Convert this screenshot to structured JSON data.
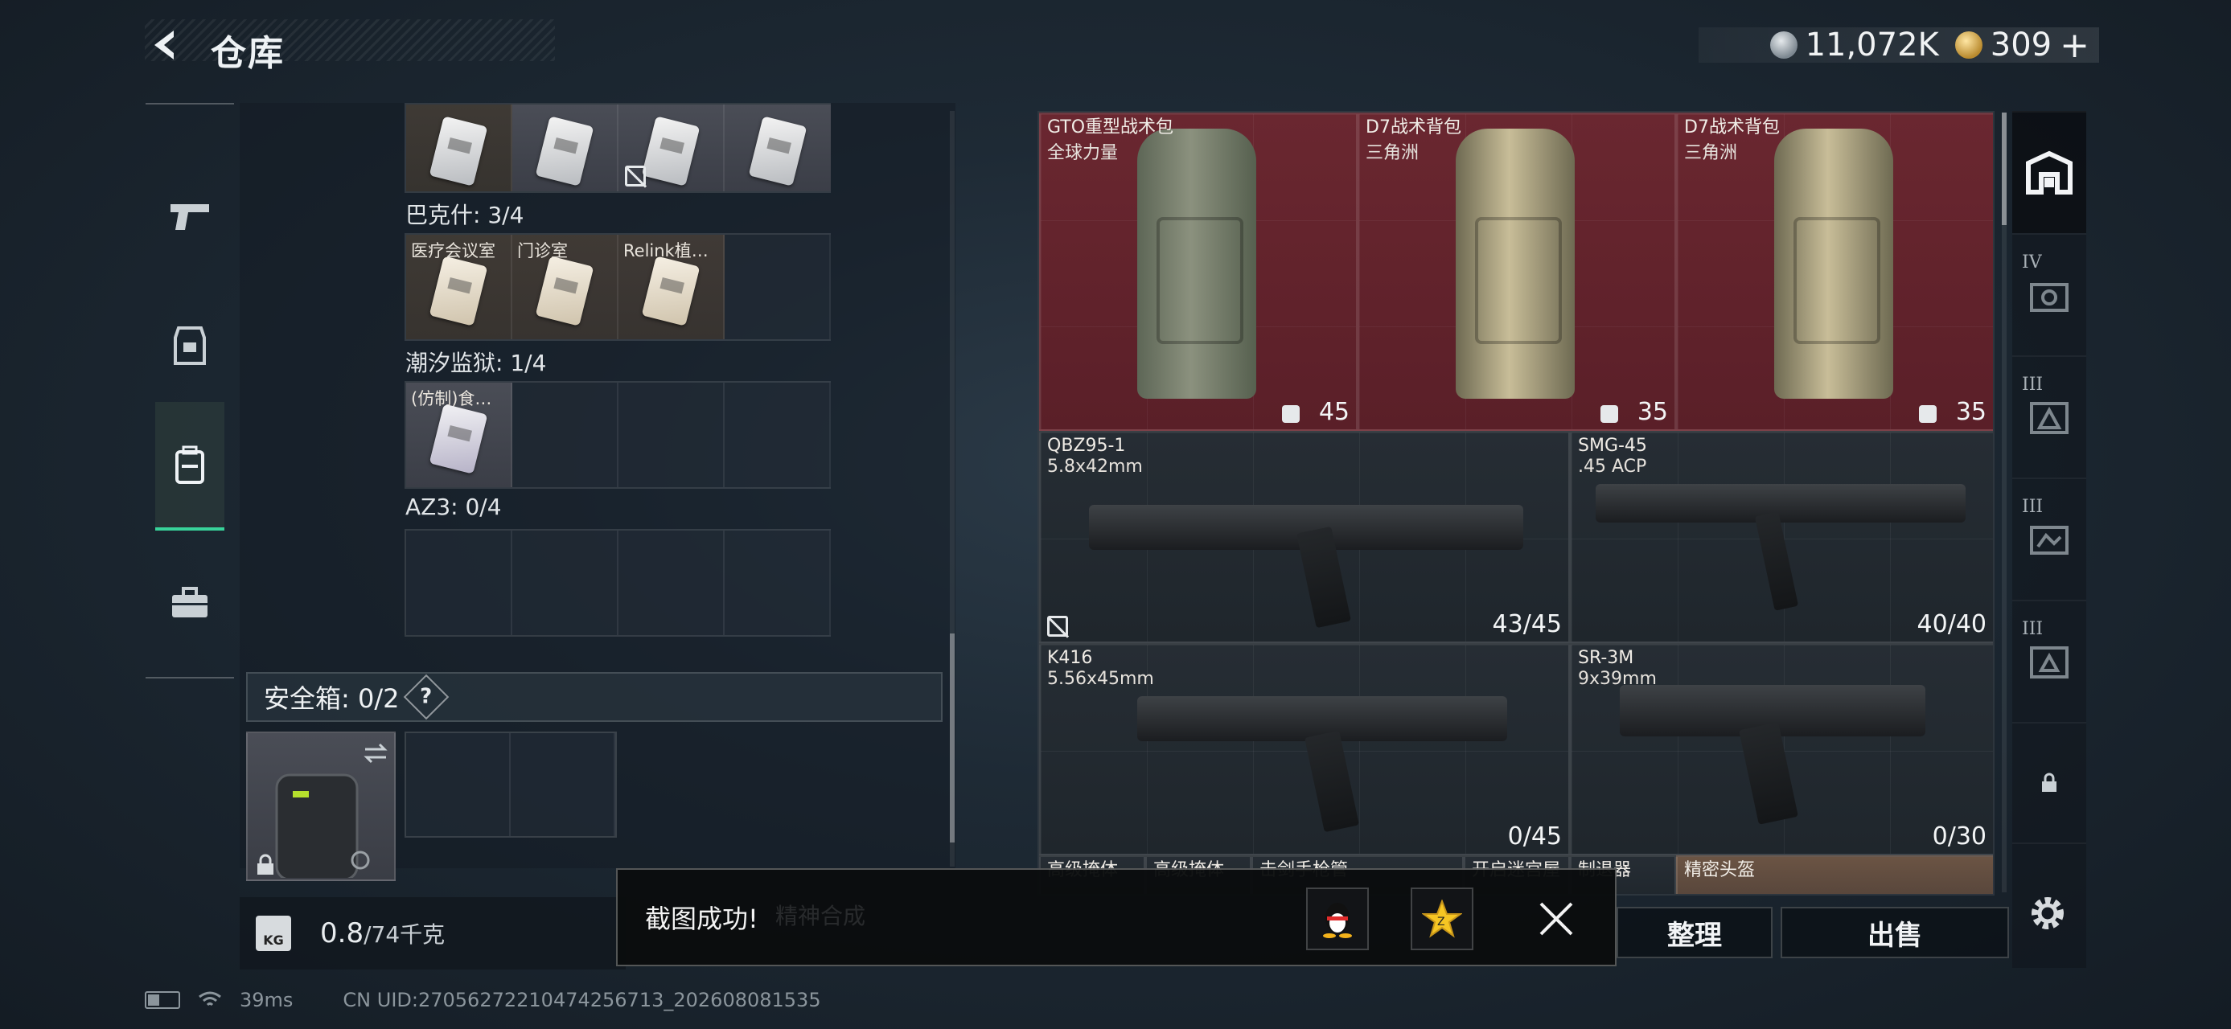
{
  "header": {
    "title": "仓库",
    "currency_silver": "11,072K",
    "currency_gold": "309",
    "currency_plus": "+"
  },
  "left_nav": {
    "items": [
      {
        "icon": "pistol-icon"
      },
      {
        "icon": "armor-vest-icon"
      },
      {
        "icon": "backpack-icon",
        "active": true
      },
      {
        "icon": "toolbox-icon"
      }
    ]
  },
  "storage": {
    "sections": [
      {
        "label": "巴克什: 3/4",
        "slots": [
          "医疗会议室",
          "门诊室",
          "Relink植…",
          ""
        ]
      },
      {
        "label": "潮汐监狱: 1/4",
        "slots": [
          "(仿制)食…",
          "",
          "",
          ""
        ]
      },
      {
        "label": "AZ3: 0/4",
        "slots": [
          "",
          "",
          "",
          ""
        ]
      }
    ],
    "safebox_label": "安全箱:  0/2",
    "help": "?",
    "weight_value": "0.8",
    "weight_capacity": "/74千克",
    "weight_icon": "KG"
  },
  "inventory": {
    "items": [
      {
        "name": "GTO重型战术包",
        "sub": "全球力量",
        "qty": "45"
      },
      {
        "name": "D7战术背包",
        "sub": "三角洲",
        "qty": "35"
      },
      {
        "name": "D7战术背包",
        "sub": "三角洲",
        "qty": "35"
      },
      {
        "name": "QBZ95-1",
        "sub": "5.8x42mm",
        "qty": "43/45"
      },
      {
        "name": "SMG-45",
        "sub": ".45 ACP",
        "qty": "40/40"
      },
      {
        "name": "K416",
        "sub": "5.56x45mm",
        "qty": "0/45"
      },
      {
        "name": "SR-3M",
        "sub": "9x39mm",
        "qty": "0/30"
      }
    ],
    "partial_row": [
      "高级掩体",
      "高级掩体",
      "击剑手枪管",
      "开启迷宫屋",
      "制退器",
      "精密头盔"
    ]
  },
  "right_nav": {
    "tiers": [
      "IV",
      "III",
      "III",
      "III"
    ]
  },
  "actions": {
    "organize": "整理",
    "sell": "出售"
  },
  "toast": {
    "message": "截图成功!",
    "hidden_text": "精神合成"
  },
  "status": {
    "ping": "39ms",
    "uid": "CN UID:27056272210474256713_202608081535"
  },
  "colors": {
    "accent": "#38d39a",
    "red_item": "#6a2730",
    "gold_coin": "#b98a2e"
  }
}
